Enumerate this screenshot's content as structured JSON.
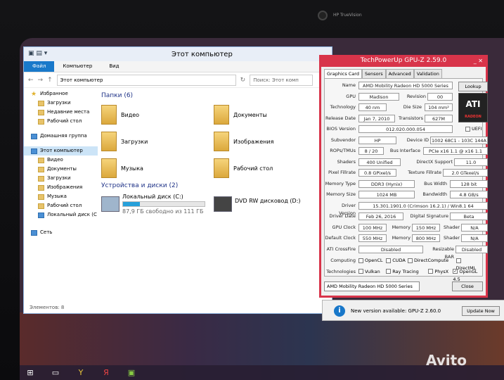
{
  "device": {
    "camera_label": "HP TrueVision"
  },
  "explorer": {
    "title": "Этот компьютер",
    "ribbon": [
      "Файл",
      "Компьютер",
      "Вид"
    ],
    "address": "Этот компьютер",
    "search_placeholder": "Поиск: Этот комп",
    "sidebar": [
      {
        "label": "Избранное",
        "icon": "star-icon"
      },
      {
        "label": "Загрузки",
        "icon": "folder-icon"
      },
      {
        "label": "Недавние места",
        "icon": "folder-icon"
      },
      {
        "label": "Рабочий стол",
        "icon": "folder-icon"
      },
      {
        "label": "Домашняя группа",
        "icon": "homegroup-icon"
      },
      {
        "label": "Этот компьютер",
        "icon": "computer-icon"
      },
      {
        "label": "Видео",
        "icon": "folder-icon"
      },
      {
        "label": "Документы",
        "icon": "folder-icon"
      },
      {
        "label": "Загрузки",
        "icon": "folder-icon"
      },
      {
        "label": "Изображения",
        "icon": "folder-icon"
      },
      {
        "label": "Музыка",
        "icon": "folder-icon"
      },
      {
        "label": "Рабочий стол",
        "icon": "folder-icon"
      },
      {
        "label": "Локальный диск (C",
        "icon": "drive-icon"
      },
      {
        "label": "Сеть",
        "icon": "network-icon"
      }
    ],
    "folders_header": "Папки (6)",
    "folders": [
      "Видео",
      "Документы",
      "Загрузки",
      "Изображения",
      "Музыка",
      "Рабочий стол"
    ],
    "devices_header": "Устройства и диски (2)",
    "drive_c": {
      "name": "Локальный диск (C:)",
      "free": "87,9 ГБ свободно из 111 ГБ",
      "used_fraction": 0.21
    },
    "drive_d": {
      "name": "DVD RW дисковод (D:)"
    },
    "status": "Элементов: 8"
  },
  "gpuz": {
    "title": "TechPowerUp GPU-Z 2.59.0",
    "tabs": [
      "Graphics Card",
      "Sensors",
      "Advanced",
      "Validation"
    ],
    "name": "AMD Mobility Radeon HD 5000 Series",
    "lookup": "Lookup",
    "gpu": "Madison",
    "revision": "00",
    "technology": "40 nm",
    "die_size": "104 mm²",
    "release_date": "Jan 7, 2010",
    "transistors": "627M",
    "bios": "012.020.000.054",
    "uefi": "UEFI",
    "subvendor": "HP",
    "device_id": "1002 68C1 - 103C 144A",
    "rops": "8 / 20",
    "bus": "PCIe x16 1.1 @ x16 1.1",
    "shaders": "400 Unified",
    "directx": "11.0",
    "pixel_fillrate": "0.8 GPixel/s",
    "texture_fillrate": "2.0 GTexel/s",
    "memory_type": "DDR3 (Hynix)",
    "bus_width": "128 bit",
    "memory_size": "1024 MB",
    "bandwidth": "4.8 GB/s",
    "driver_version": "15.301.1901.0 (Crimson 16.2.1) / Win8.1 64",
    "driver_date": "Feb 26, 2016",
    "digital_signature": "Beta",
    "gpu_clock": "100 MHz",
    "memory_clock": "150 MHz",
    "shader_clock": "N/A",
    "default_clock": "550 MHz",
    "default_memory": "800 MHz",
    "default_shader": "N/A",
    "crossfire": "Disabled",
    "resizable_bar": "Disabled",
    "computing": [
      [
        "OpenCL",
        false
      ],
      [
        "CUDA",
        false
      ],
      [
        "DirectCompute",
        false
      ],
      [
        "DirectML",
        false
      ]
    ],
    "technologies": [
      [
        "Vulkan",
        false
      ],
      [
        "Ray Tracing",
        false
      ],
      [
        "PhysX",
        false
      ],
      [
        "OpenGL 4.5",
        true
      ]
    ],
    "labels": {
      "name": "Name",
      "gpu": "GPU",
      "revision": "Revision",
      "technology": "Technology",
      "die": "Die Size",
      "release": "Release Date",
      "transistors": "Transistors",
      "bios": "BIOS Version",
      "subvendor": "Subvendor",
      "device": "Device ID",
      "rops": "ROPs/TMUs",
      "bus": "Bus Interface",
      "shaders": "Shaders",
      "dx": "DirectX Support",
      "pixel": "Pixel Fillrate",
      "texture": "Texture Fillrate",
      "memtype": "Memory Type",
      "buswidth": "Bus Width",
      "memsize": "Memory Size",
      "bandwidth": "Bandwidth",
      "driver": "Driver Version",
      "driverdate": "Driver Date",
      "sig": "Digital Signature",
      "gpuclock": "GPU Clock",
      "memory": "Memory",
      "shader": "Shader",
      "defclock": "Default Clock",
      "crossfire": "ATI CrossFire",
      "rebar": "Resizable BAR",
      "computing": "Computing",
      "tech": "Technologies"
    },
    "card_select": "AMD Mobility Radeon HD 5000 Series",
    "close": "Close",
    "logo_text": "ATI",
    "logo_sub": "RADEON"
  },
  "notification": {
    "text": "New version available: GPU-Z 2.60.0",
    "button": "Update Now"
  },
  "watermark": "Avito",
  "colors": {
    "gpuz_frame": "#d8344a",
    "explorer_accent": "#1979ca"
  }
}
